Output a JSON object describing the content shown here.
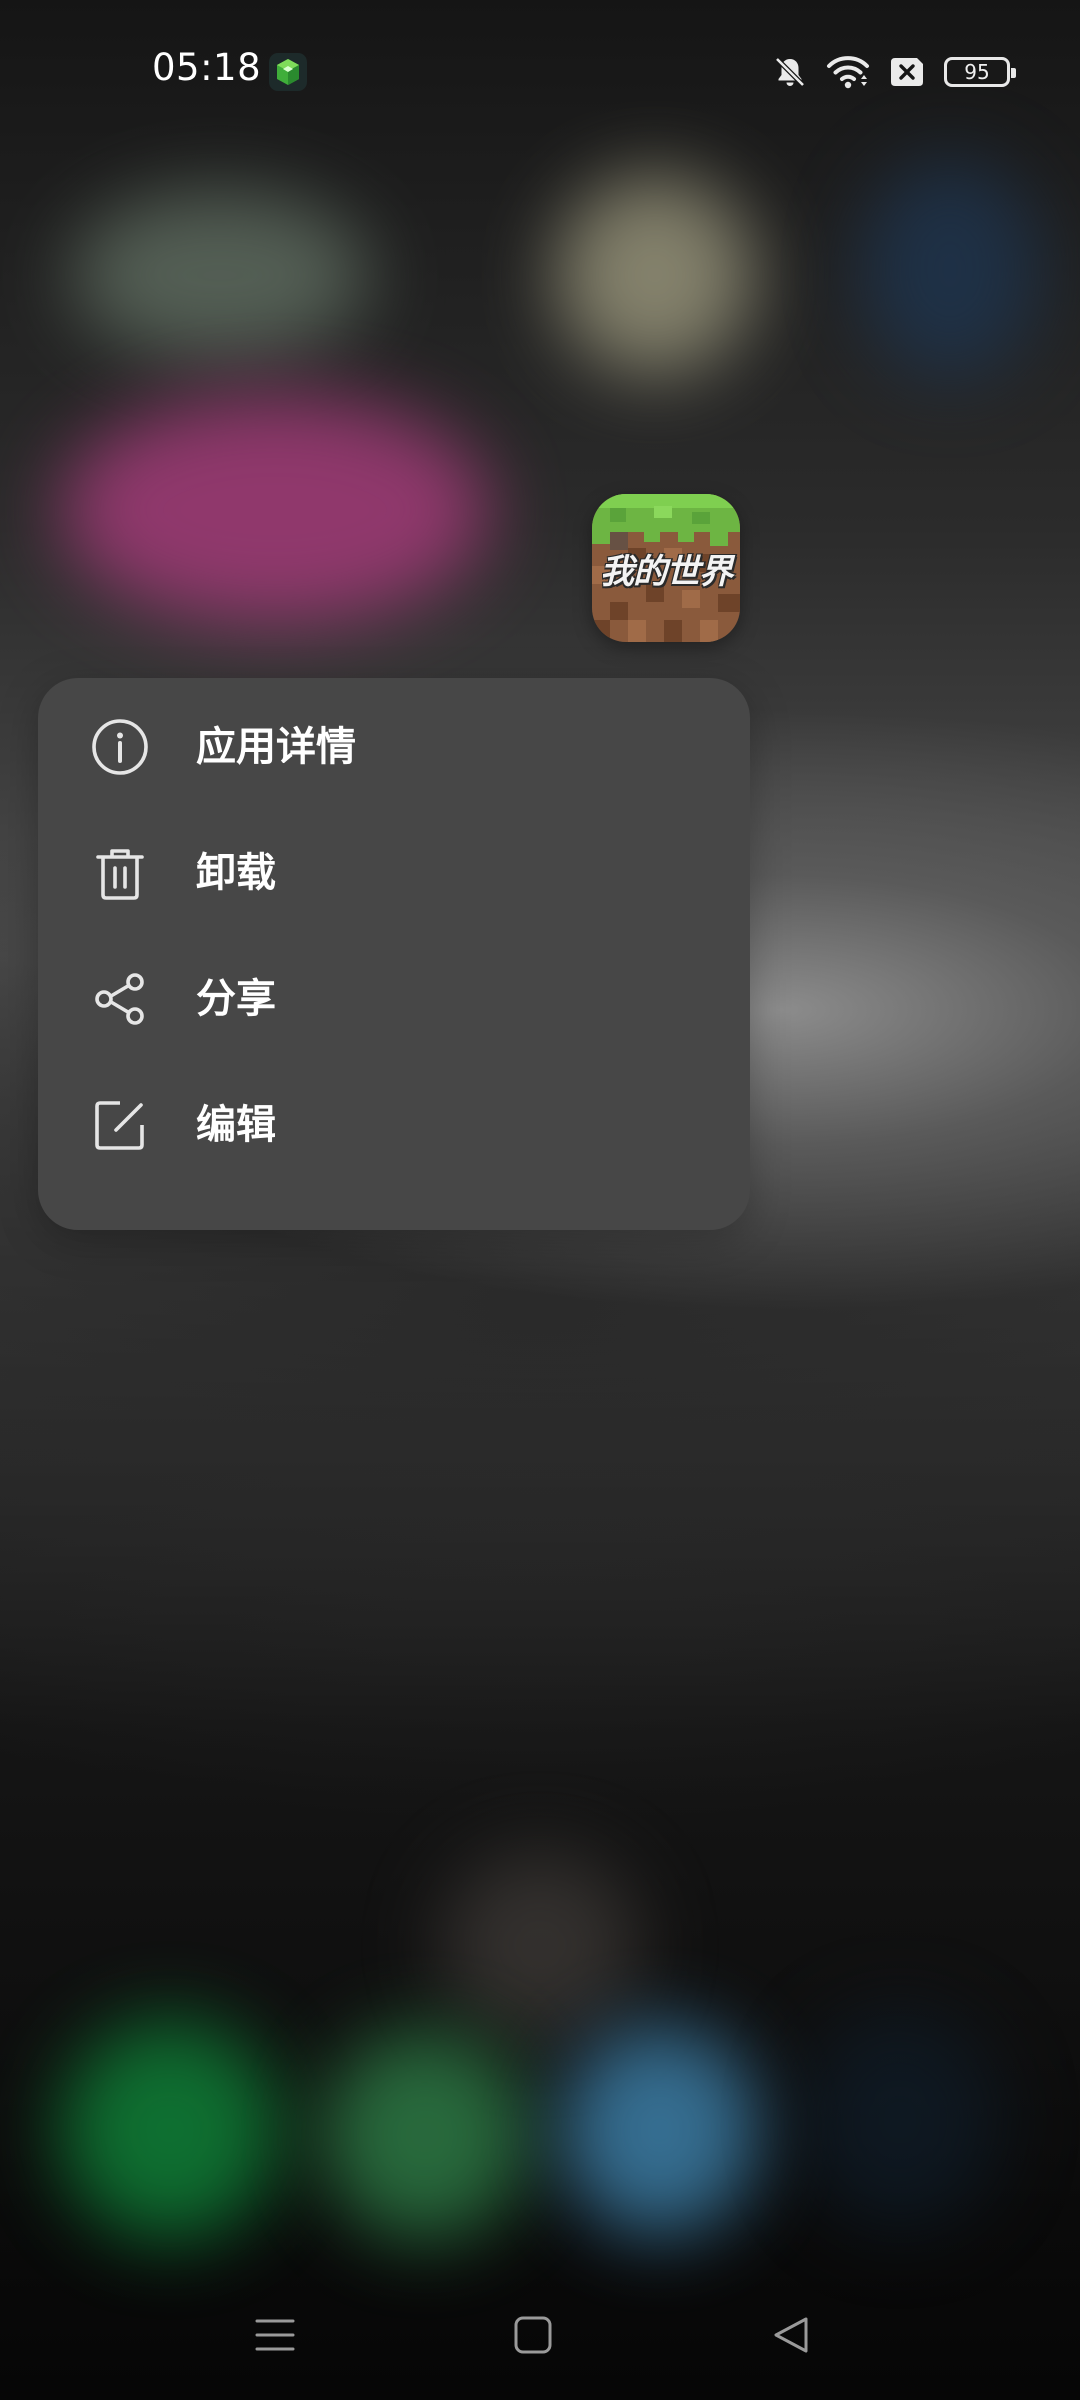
{
  "status_bar": {
    "time": "05:18",
    "notification_icon": "green-cube-app-icon",
    "icons": [
      "mute-bell-icon",
      "wifi-icon",
      "no-sim-icon",
      "battery-icon"
    ],
    "battery_level": "95"
  },
  "app_icon": {
    "title": "我的世界",
    "icon": "minecraft-grass-block-icon"
  },
  "context_menu": {
    "items": [
      {
        "label": "应用详情",
        "icon": "info-icon"
      },
      {
        "label": "卸载",
        "icon": "trash-icon"
      },
      {
        "label": "分享",
        "icon": "share-icon"
      },
      {
        "label": "编辑",
        "icon": "edit-icon"
      }
    ]
  },
  "navigation_bar": {
    "buttons": [
      "menu-icon",
      "home-icon",
      "back-icon"
    ]
  },
  "colors": {
    "menu_background": "#474747",
    "menu_text": "#ffffff",
    "icon_stroke": "#e6e6e6"
  }
}
